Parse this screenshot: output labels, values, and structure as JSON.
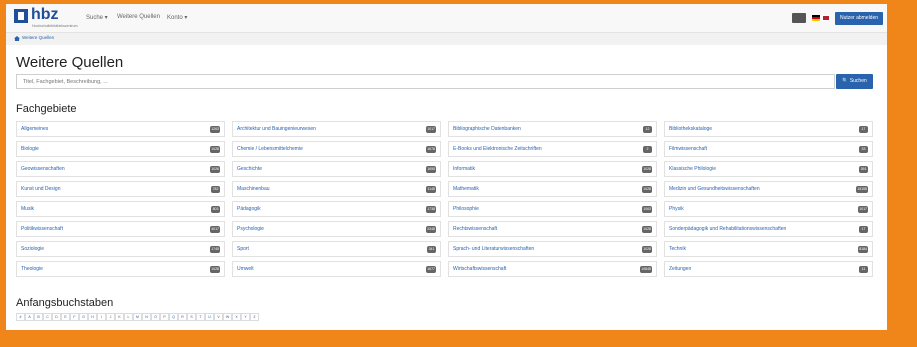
{
  "header": {
    "logo": "hbz",
    "logo_sub": "Hochschulbibliothekszentrum",
    "nav": [
      "Suche ▾",
      "Weitere Quellen",
      "Konto ▾"
    ],
    "login": "Nutzer abmelden"
  },
  "breadcrumb": "Weitere Quellen",
  "page_title": "Weitere Quellen",
  "search": {
    "placeholder": "Titel, Fachgebiet, Beschreibung, ...",
    "button": "🔍 Suchen"
  },
  "fachgebiete_title": "Fachgebiete",
  "fachgebiete": [
    {
      "label": "Allgemeines",
      "count": "1263"
    },
    {
      "label": "Architektur und Bauingenieurwesen",
      "count": "1017"
    },
    {
      "label": "Bibliographische Datenbanken",
      "count": "12"
    },
    {
      "label": "Bibliothekskataloge",
      "count": "17"
    },
    {
      "label": "Biologie",
      "count": "1028"
    },
    {
      "label": "Chemie / Lebensmittelchemie",
      "count": "1678"
    },
    {
      "label": "E-Books und Elektronische Zeitschriften",
      "count": "2"
    },
    {
      "label": "Filmwissenschaft",
      "count": "33"
    },
    {
      "label": "Geowissenschaften",
      "count": "1026"
    },
    {
      "label": "Geschichte",
      "count": "1655"
    },
    {
      "label": "Informatik",
      "count": "1028"
    },
    {
      "label": "Klassische Philologie",
      "count": "391"
    },
    {
      "label": "Kunst und Design",
      "count": "782"
    },
    {
      "label": "Maschinenbau",
      "count": "1145"
    },
    {
      "label": "Mathematik",
      "count": "1028"
    },
    {
      "label": "Medizin und Gesundheitswissenschaften",
      "count": "15155"
    },
    {
      "label": "Musik",
      "count": "803"
    },
    {
      "label": "Pädagogik",
      "count": "1738"
    },
    {
      "label": "Philosophie",
      "count": "1063"
    },
    {
      "label": "Physik",
      "count": "1017"
    },
    {
      "label": "Politikwissenschaft",
      "count": "4017"
    },
    {
      "label": "Psychologie",
      "count": "2348"
    },
    {
      "label": "Rechtswissenschaft",
      "count": "1028"
    },
    {
      "label": "Sonderpädagogik und Rehabilitationswissenschaften",
      "count": "17"
    },
    {
      "label": "Soziologie",
      "count": "1745"
    },
    {
      "label": "Sport",
      "count": "341"
    },
    {
      "label": "Sprach- und Literaturwissenschaften",
      "count": "1028"
    },
    {
      "label": "Technik",
      "count": "8184"
    },
    {
      "label": "Theologie",
      "count": "1028"
    },
    {
      "label": "Umwelt",
      "count": "1677"
    },
    {
      "label": "Wirtschaftswissenschaft",
      "count": "10845"
    },
    {
      "label": "Zeitungen",
      "count": "11"
    }
  ],
  "anfang_title": "Anfangsbuchstaben",
  "letters": [
    "#",
    "A",
    "B",
    "C",
    "D",
    "E",
    "F",
    "G",
    "H",
    "I",
    "J",
    "K",
    "L",
    "M",
    "N",
    "O",
    "P",
    "Q",
    "R",
    "S",
    "T",
    "U",
    "V",
    "W",
    "X",
    "Y",
    "Z"
  ],
  "colors": {
    "accent": "#2a63ad",
    "frame": "#f08519",
    "badge": "#666666"
  }
}
